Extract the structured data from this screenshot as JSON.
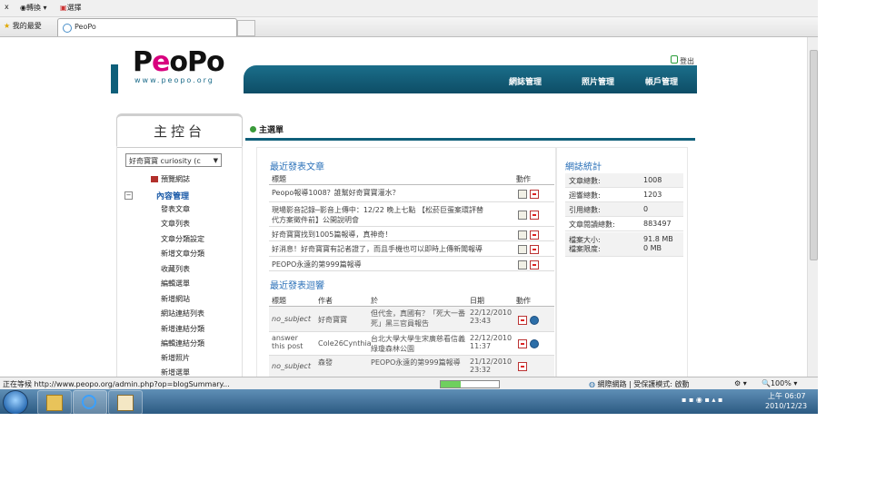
{
  "browser": {
    "cmd_close": "x",
    "cmd_convert": "轉換",
    "cmd_select": "選擇",
    "favorites": "我的最愛",
    "tab_title": "PeoPo"
  },
  "header": {
    "logo_p": "P",
    "logo_e": "e",
    "logo_opo": "oPo",
    "logo_url": "www.peopo.org",
    "logout": "登出",
    "nav": [
      "網誌管理",
      "照片管理",
      "帳戶管理"
    ]
  },
  "sidebar": {
    "title": "主控台",
    "blog_select": "好奇寶寶 curiosity (c",
    "preview": "預覽網誌",
    "tree_toggle": "−",
    "section": "內容管理",
    "items": [
      "發表文章",
      "文章列表",
      "文章分類設定",
      "新增文章分類",
      "收藏列表",
      "編輯選單",
      "新增網站",
      "網站連結列表",
      "新增連結分類",
      "編輯連結分類",
      "新增照片",
      "新增選單"
    ]
  },
  "main": {
    "title": "主選單",
    "recent_posts": {
      "heading": "最近發表文章",
      "col_title": "標題",
      "col_action": "動作",
      "rows": [
        "Peopo報導1008？誰幫好奇寶寶灌水？",
        "現場影音記錄─影音上傳中：12/22 晚上七點 【松菸巨蛋案環評替代方案徵件前】公開說明會",
        "好奇寶寶找到1005篇報導，真神奇！",
        "好消息！好奇寶寶有記者證了，而且手機也可以即時上傳新聞報導",
        "PEOPO永遠的第999篇報導"
      ]
    },
    "recent_comments": {
      "heading": "最近發表迴響",
      "col_title": "標題",
      "col_author": "作者",
      "col_on": "於",
      "col_date": "日期",
      "col_action": "動作",
      "rows": [
        {
          "title": "no_subject",
          "author": "好奇寶寶",
          "on": "但代金，真國有？「死大一番死」黑三官員報告",
          "date": "22/12/2010 23:43"
        },
        {
          "title": "answer this post",
          "author": "Cole26Cynthia",
          "on": "台北大學大學生宋廣慈看信義綠瓊森林公園",
          "date": "22/12/2010 11:37"
        },
        {
          "title": "no_subject",
          "author": "森發",
          "on": "PEOPO永遠的第999篇報導",
          "date": "21/12/2010 23:32"
        }
      ]
    }
  },
  "stats": {
    "heading": "網誌統計",
    "rows": [
      {
        "label": "文章總數:",
        "value": "1008"
      },
      {
        "label": "迴響總數:",
        "value": "1203"
      },
      {
        "label": "引用總數:",
        "value": "0"
      },
      {
        "label": "文章閱讀總數:",
        "value": "883497"
      },
      {
        "label": "檔案大小:",
        "value": "91.8 MB"
      },
      {
        "label": "檔案限度:",
        "value": "0 MB"
      }
    ]
  },
  "statusbar": {
    "text": "正在等候 http://www.peopo.org/admin.php?op=blogSummary...",
    "progress": 0.35,
    "zone": "網際網路 | 受保護模式: 啟動",
    "zoom": "100%"
  },
  "taskbar": {
    "time": "上午 06:07",
    "date": "2010/12/23"
  }
}
